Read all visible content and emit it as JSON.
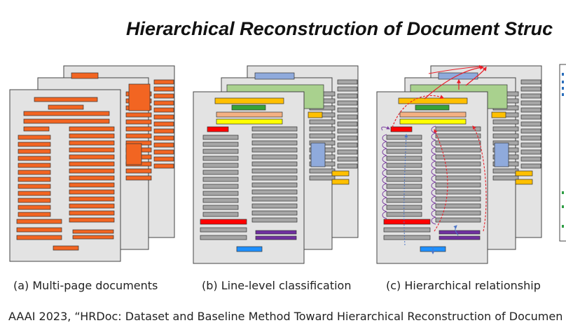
{
  "slide": {
    "title": "Hierarchical Reconstruction of Document Struc",
    "captions": [
      "(a) Multi-page documents",
      "(b) Line-level classification",
      "(c) Hierarchical relationship"
    ],
    "footer": "AAAI 2023, “HRDoc: Dataset and Baseline Method Toward Hierarchical Reconstruction of Documen"
  },
  "colors": {
    "page_fill": "#e3e3e3",
    "page_border": "#444444",
    "orange": "#f26522",
    "gray_line": "#a6a6a6",
    "title_block": "#a9d18e",
    "blue_block": "#8faadc",
    "salmon": "#f4b183",
    "yellow": "#ffff00",
    "gold": "#ffc000",
    "dark_green": "#38a238",
    "red": "#ff0000",
    "purple": "#7030a0",
    "cyan": "#1e90ff",
    "arrow_red": "#e8202a",
    "arrow_purple": "#7b3fa0",
    "arrow_blue": "#4a74c8",
    "json_text": "#2a6ebb",
    "json_brace": "#2e9e44"
  },
  "panels": [
    {
      "name": "multi-page-documents",
      "style": "orange"
    },
    {
      "name": "line-level-classification",
      "style": "classified"
    },
    {
      "name": "hierarchical-relationship",
      "style": "hierarchy"
    }
  ]
}
